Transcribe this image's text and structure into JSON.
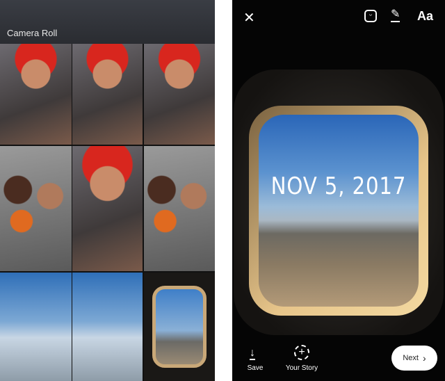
{
  "camera_roll": {
    "title": "Camera Roll",
    "photos": [
      "selfie-heart-glasses",
      "selfie-heart-glasses",
      "selfie-heart-glasses",
      "group-selfie",
      "selfie-red-hat",
      "airport-selfie",
      "sky-clouds",
      "airplane-wing",
      "airplane-window"
    ]
  },
  "story_editor": {
    "toolbar": {
      "close": "close-icon",
      "sticker": "sticker-icon",
      "draw": "pen-icon",
      "text_label": "Aa"
    },
    "date_sticker": "NOV 5, 2017",
    "bottom": {
      "save_label": "Save",
      "your_story_label": "Your Story",
      "next_label": "Next"
    }
  }
}
